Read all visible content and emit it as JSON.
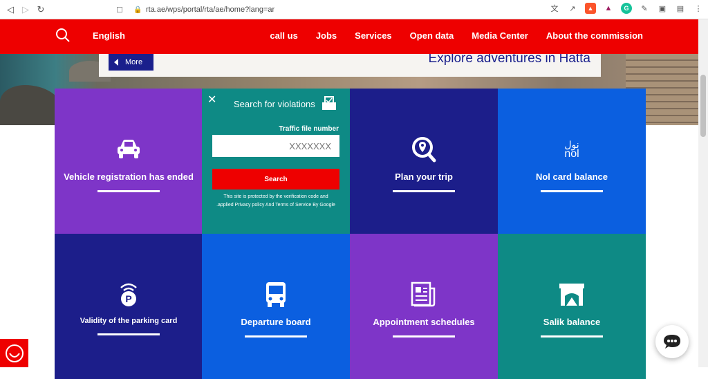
{
  "browser": {
    "url": "rta.ae/wps/portal/rta/ae/home?lang=ar"
  },
  "header": {
    "language": "English",
    "menu": [
      "call us",
      "Jobs",
      "Services",
      "Open data",
      "Media Center",
      "About the commission"
    ]
  },
  "hero": {
    "more_label": "More",
    "headline": "Explore adventures in Hatta"
  },
  "violation_search": {
    "title": "Search for violations",
    "field_label": "Traffic file number",
    "field_placeholder": "XXXXXXX",
    "button_label": "Search",
    "notice_line1": "This site is protected by the verification code and",
    "notice_line2": ".applied Privacy policy And Terms of Service By Google"
  },
  "tiles": [
    {
      "label": "Vehicle registration has ended",
      "color": "#7e35c8"
    },
    {
      "label": "Plan your trip",
      "color": "#1c1e8a"
    },
    {
      "label": "Nol card balance",
      "color": "#0b5fe0",
      "logo_ar": "نول",
      "logo_en": "nol"
    },
    {
      "label": "Validity of the parking card",
      "color": "#1c1e8a"
    },
    {
      "label": "Departure board",
      "color": "#0b5fe0"
    },
    {
      "label": "Appointment schedules",
      "color": "#7e35c8"
    },
    {
      "label": "Salik balance",
      "color": "#0e8a85"
    }
  ],
  "colors": {
    "header_red": "#ee0000",
    "violation_teal": "#0e8a85"
  }
}
